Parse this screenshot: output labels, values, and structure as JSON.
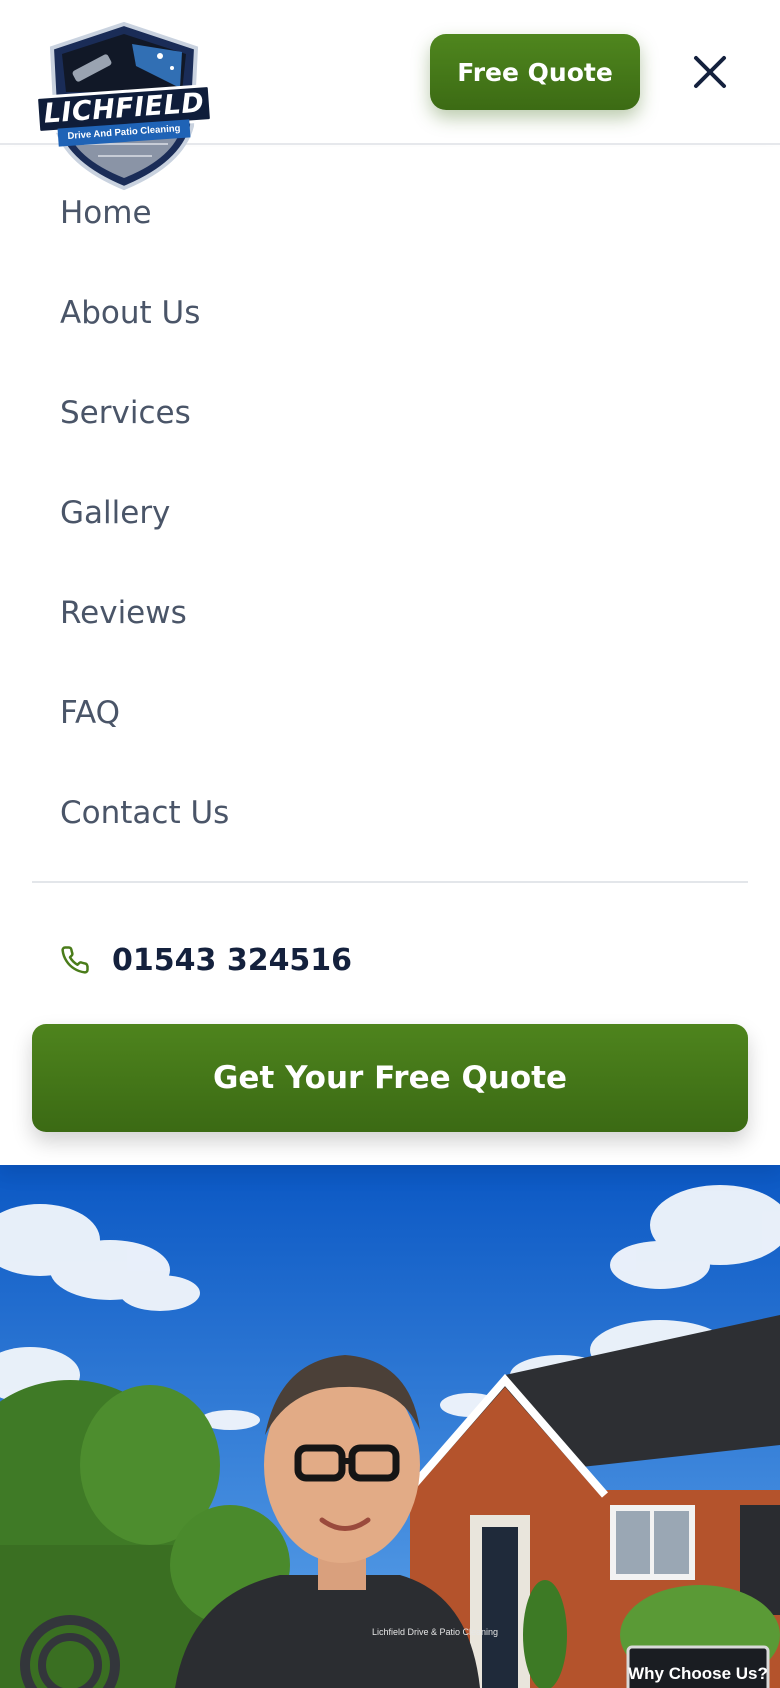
{
  "brand": {
    "name": "LICHFIELD",
    "tagline": "Drive And Patio Cleaning"
  },
  "header": {
    "free_quote_label": "Free Quote",
    "close_icon": "close-icon"
  },
  "menu": {
    "items": [
      {
        "label": "Home"
      },
      {
        "label": "About Us"
      },
      {
        "label": "Services"
      },
      {
        "label": "Gallery"
      },
      {
        "label": "Reviews"
      },
      {
        "label": "FAQ"
      },
      {
        "label": "Contact Us"
      }
    ],
    "phone": {
      "icon": "phone-icon",
      "number": "01543 324516"
    },
    "cta_label": "Get Your Free Quote"
  },
  "hero": {
    "shirt_text": "Lichfield Drive & Patio Cleaning",
    "sign_text": "Why Choose Us?"
  },
  "colors": {
    "brand_green": "#4a7c1a",
    "nav_text": "#4a5568",
    "dark_navy": "#14213d",
    "logo_blue": "#1f63b6"
  }
}
